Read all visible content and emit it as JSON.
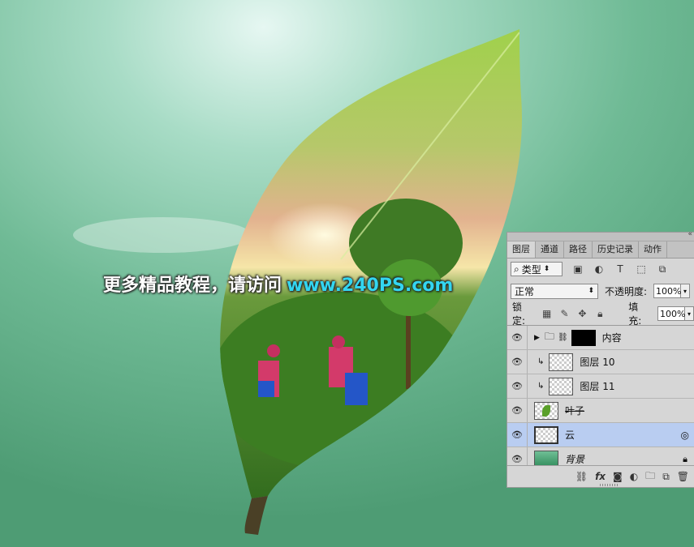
{
  "watermark": {
    "text_cn": "更多精品教程，请访问",
    "url": "www.240PS.com"
  },
  "panel": {
    "tabs": [
      "图层",
      "通道",
      "路径",
      "历史记录",
      "动作"
    ],
    "filter_label": "类型",
    "blend_mode": "正常",
    "opacity_label": "不透明度:",
    "opacity_value": "100%",
    "lock_label": "锁定:",
    "fill_label": "填充:",
    "fill_value": "100%",
    "layers": [
      {
        "name": "内容",
        "type": "group"
      },
      {
        "name": "图层 10",
        "type": "clipped"
      },
      {
        "name": "图层 11",
        "type": "clipped"
      },
      {
        "name": "叶子",
        "type": "smart"
      },
      {
        "name": "云",
        "type": "smart",
        "selected": true
      },
      {
        "name": "背景",
        "type": "background",
        "locked": true
      }
    ]
  },
  "colors": {
    "background": "#5aa882",
    "selected_layer": "#b9cdf1",
    "url_color": "#33d6f0"
  }
}
